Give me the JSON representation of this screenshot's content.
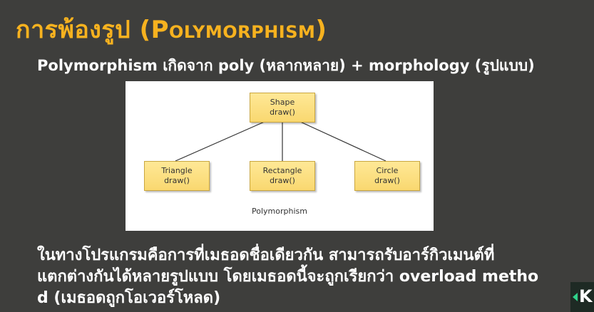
{
  "slide": {
    "title_th": "การพ้องรูป ",
    "title_en": "(Polymorphism)",
    "subtitle": "Polymorphism เกิดจาก poly (หลากหลาย) + morphology (รูปแบบ)",
    "diagram": {
      "root": {
        "name": "Shape",
        "method": "draw()"
      },
      "children": [
        {
          "name": "Triangle",
          "method": "draw()"
        },
        {
          "name": "Rectangle",
          "method": "draw()"
        },
        {
          "name": "Circle",
          "method": "draw()"
        }
      ],
      "caption": "Polymorphism"
    },
    "body_lines": [
      "ในทางโปรแกรมคือการที่เมธอดชื่อเดียวกัน สามารถรับอาร์กิวเมนต์ที่",
      "แตกต่างกันได้หลายรูปแบบ โดยเมธอดนี้จะถูกเรียกว่า overload metho",
      "d (เมธอดถูกโอเวอร์โหลด)"
    ],
    "corner_logo": "K"
  },
  "colors": {
    "background": "#3e3e3c",
    "title": "#f7b21f",
    "text": "#ffffff",
    "node_fill": "#f9d870"
  }
}
